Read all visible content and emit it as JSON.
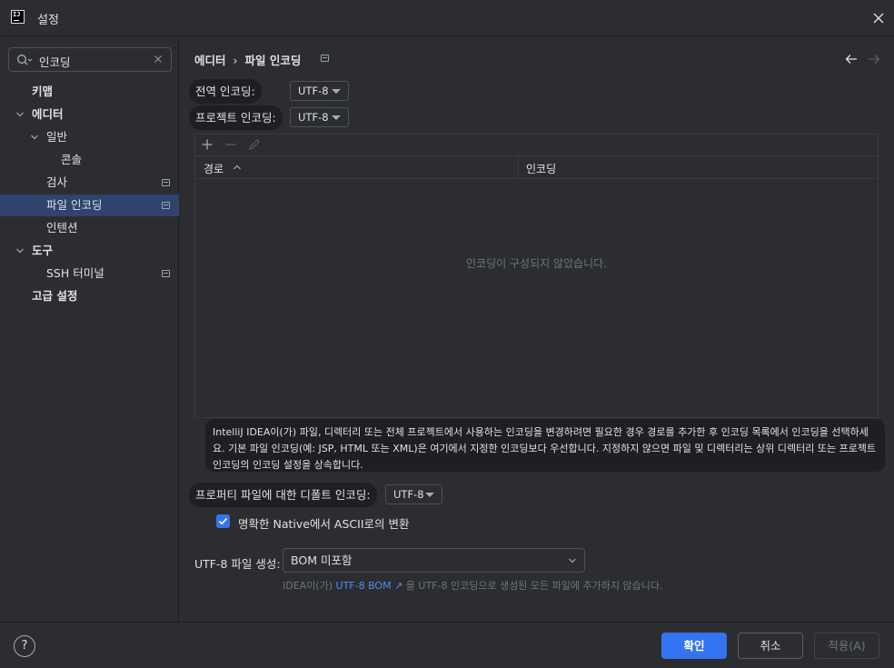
{
  "window": {
    "title": "설정",
    "logo_text": "IJ"
  },
  "search": {
    "value": "인코딩"
  },
  "sidebar": {
    "items": [
      {
        "label": "키맵"
      },
      {
        "label": "에디터"
      },
      {
        "label": "일반"
      },
      {
        "label": "콘솔"
      },
      {
        "label": "검사"
      },
      {
        "label": "파일 인코딩"
      },
      {
        "label": "인텐션"
      },
      {
        "label": "도구"
      },
      {
        "label": "SSH 터미널"
      },
      {
        "label": "고급 설정"
      }
    ]
  },
  "breadcrumb": {
    "parent": "에디터",
    "separator": "›",
    "current": "파일 인코딩"
  },
  "global_encoding": {
    "label": "전역 인코딩:",
    "value": "UTF-8"
  },
  "project_encoding": {
    "label": "프로젝트 인코딩:",
    "value": "UTF-8"
  },
  "table": {
    "columns": [
      "경로",
      "인코딩"
    ],
    "empty_text": "인코딩이 구성되지 않았습니다."
  },
  "info_text": "IntelliJ IDEA이(가) 파일, 디렉터리 또는 전체 프로젝트에서 사용하는 인코딩을 변경하려면 필요한 경우 경로를 추가한 후 인코딩 목록에서 인코딩을 선택하세요. 기본 파일 인코딩(예: JSP, HTML 또는 XML)은 여기에서 지정한 인코딩보다 우선합니다. 지정하지 않으면 파일 및 디렉터리는 상위 디렉터리 또는 프로젝트 인코딩의 인코딩 설정을 상속합니다.",
  "properties_encoding": {
    "label": "프로퍼티 파일에 대한 디폴트 인코딩:",
    "value": "UTF-8"
  },
  "native_ascii": {
    "label": "명확한 Native에서 ASCII로의 변환",
    "checked": true
  },
  "utf8_files": {
    "label": "UTF-8 파일 생성:",
    "value": "BOM 미포함",
    "hint_prefix": "IDEA이(가)",
    "hint_link": "UTF-8 BOM ↗",
    "hint_suffix": "을 UTF-8 인코딩으로 생성된 모든 파일에 추가하지 않습니다."
  },
  "footer": {
    "help": "?",
    "ok": "확인",
    "cancel": "취소",
    "apply": "적용(A)"
  },
  "colors": {
    "accent": "#3574f0",
    "selection": "#2e436e",
    "background": "#2b2d30",
    "link": "#548af7"
  }
}
